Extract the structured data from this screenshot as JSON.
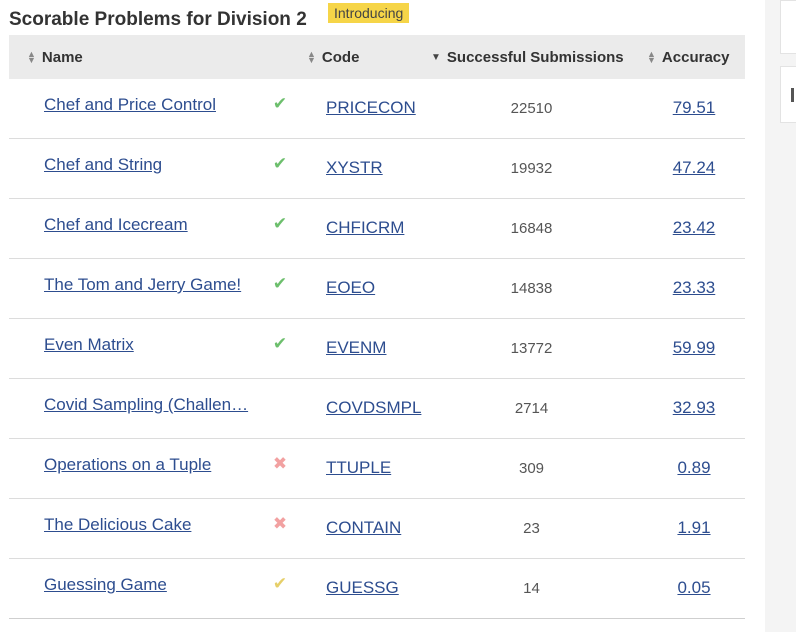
{
  "page": {
    "title": "Scorable Problems for Division 2",
    "badge": "Introducing"
  },
  "table": {
    "headers": {
      "name": "Name",
      "code": "Code",
      "successful": "Successful Submissions",
      "accuracy": "Accuracy"
    },
    "rows": [
      {
        "name": "Chef and Price Control",
        "status": "accepted",
        "code": "PRICECON",
        "successful": "22510",
        "accuracy": "79.51"
      },
      {
        "name": "Chef and String",
        "status": "accepted",
        "code": "XYSTR",
        "successful": "19932",
        "accuracy": "47.24"
      },
      {
        "name": "Chef and Icecream",
        "status": "accepted",
        "code": "CHFICRM",
        "successful": "16848",
        "accuracy": "23.42"
      },
      {
        "name": "The Tom and Jerry Game!",
        "status": "accepted",
        "code": "EOEO",
        "successful": "14838",
        "accuracy": "23.33"
      },
      {
        "name": "Even Matrix",
        "status": "accepted",
        "code": "EVENM",
        "successful": "13772",
        "accuracy": "59.99"
      },
      {
        "name": "Covid Sampling (Challen…",
        "status": "none",
        "code": "COVDSMPL",
        "successful": "2714",
        "accuracy": "32.93"
      },
      {
        "name": "Operations on a Tuple",
        "status": "wrong",
        "code": "TTUPLE",
        "successful": "309",
        "accuracy": "0.89"
      },
      {
        "name": "The Delicious Cake",
        "status": "wrong",
        "code": "CONTAIN",
        "successful": "23",
        "accuracy": "1.91"
      },
      {
        "name": "Guessing Game",
        "status": "partial",
        "code": "GUESSG",
        "successful": "14",
        "accuracy": "0.05"
      }
    ]
  },
  "icons": {
    "accepted": "check-icon",
    "wrong": "cross-icon",
    "partial": "partial-check-icon"
  },
  "colors": {
    "link": "#2d4d8f",
    "accepted": "#6dbf6d",
    "wrong": "#f2a1a1",
    "partial": "#e6cf69",
    "badge": "#f6d548",
    "header_bg": "#ebebeb"
  }
}
